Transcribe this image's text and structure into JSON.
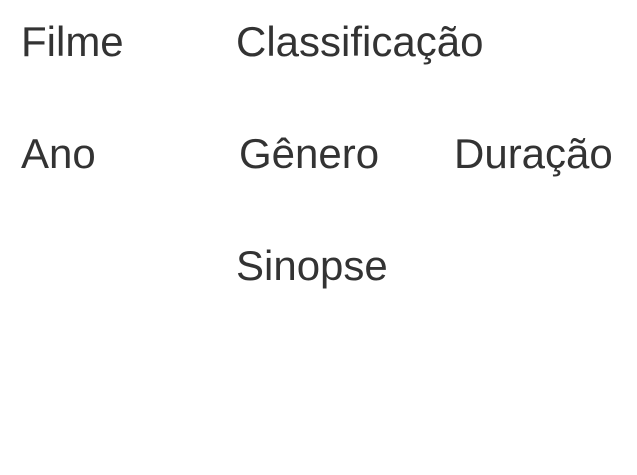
{
  "fields": {
    "filme": "Filme",
    "classificacao": "Classificação",
    "ano": "Ano",
    "genero": "Gênero",
    "duracao": "Duração",
    "sinopse": "Sinopse"
  }
}
